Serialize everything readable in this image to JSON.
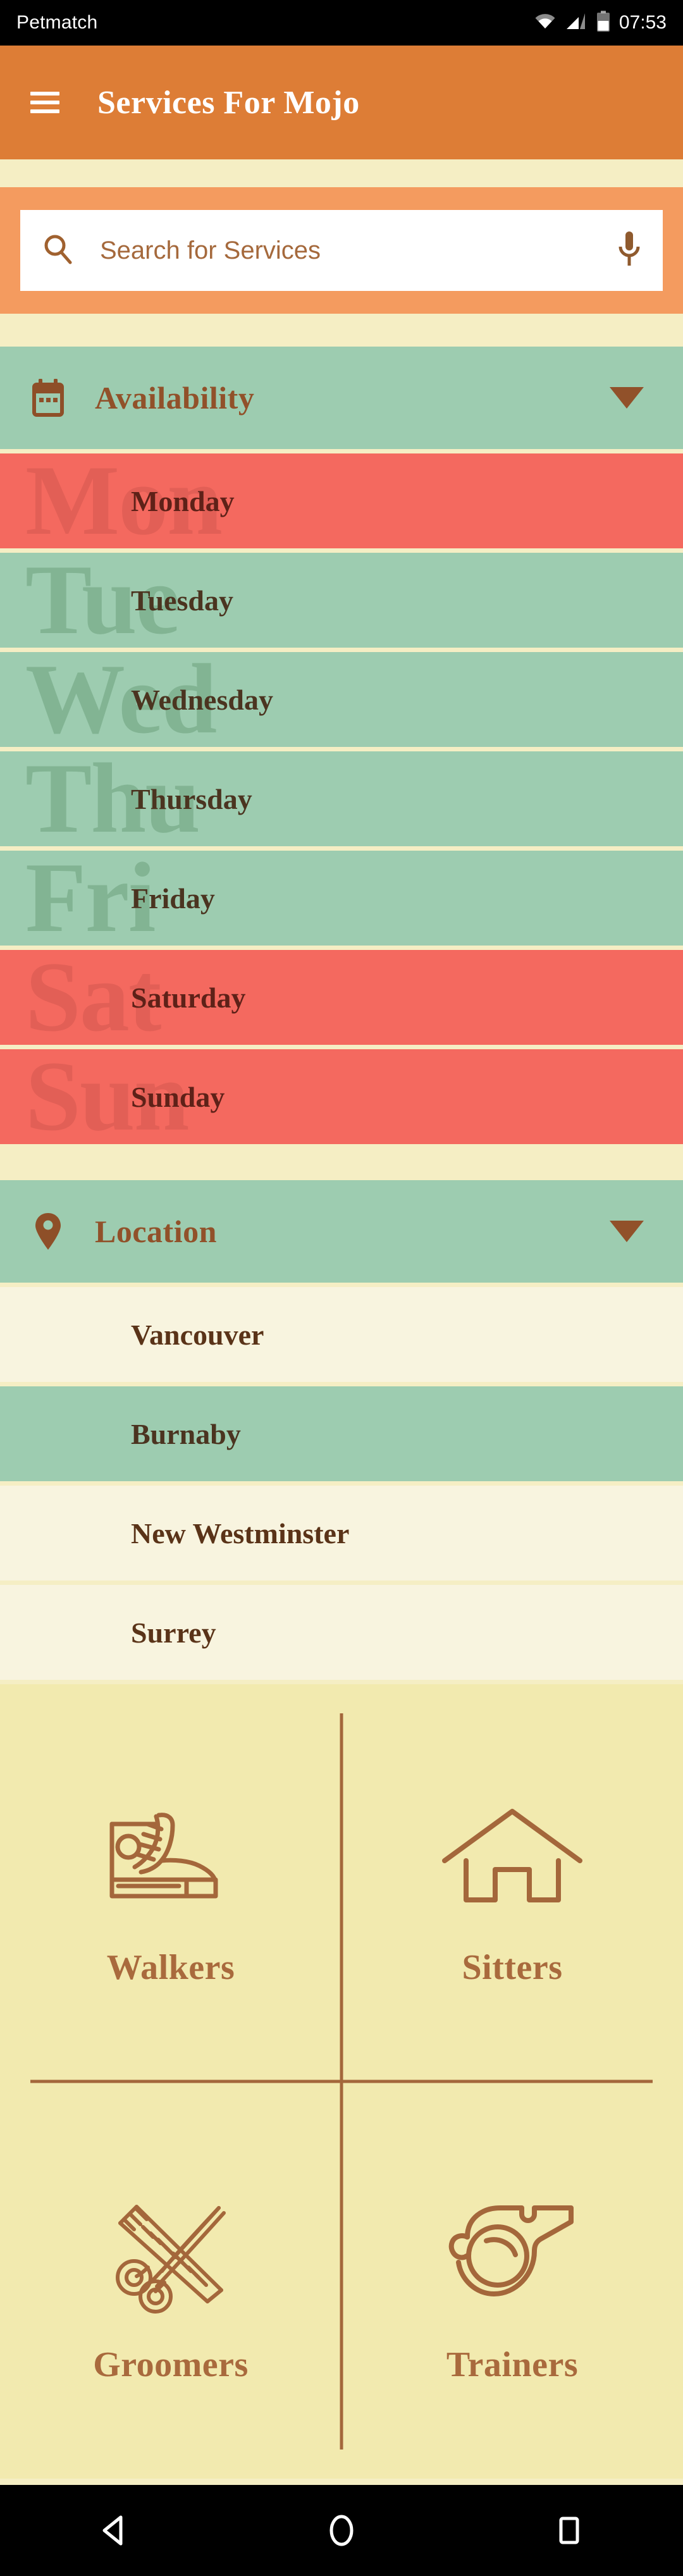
{
  "status_bar": {
    "carrier": "Petmatch",
    "clock": "07:53",
    "icons": [
      "wifi-icon",
      "cellular-signal-icon",
      "battery-icon"
    ]
  },
  "app_bar": {
    "menu_icon": "hamburger-menu-icon",
    "title": "Services For Mojo",
    "background": "#DD7D36"
  },
  "search": {
    "placeholder": "Search for Services",
    "value": "",
    "search_icon": "search-icon",
    "mic_icon": "microphone-icon",
    "bar_background": "#F49B5F"
  },
  "availability": {
    "icon": "calendar-icon",
    "title": "Availability",
    "caret": "chevron-down-icon",
    "header_background": "#9DCCB0",
    "days": [
      {
        "label": "Monday",
        "watermark": "Mon",
        "state": "unavailable"
      },
      {
        "label": "Tuesday",
        "watermark": "Tue",
        "state": "available"
      },
      {
        "label": "Wednesday",
        "watermark": "Wed",
        "state": "available"
      },
      {
        "label": "Thursday",
        "watermark": "Thu",
        "state": "available"
      },
      {
        "label": "Friday",
        "watermark": "Fri",
        "state": "available"
      },
      {
        "label": "Saturday",
        "watermark": "Sat",
        "state": "unavailable"
      },
      {
        "label": "Sunday",
        "watermark": "Sun",
        "state": "unavailable"
      }
    ],
    "colors": {
      "available": "#9DCCB0",
      "unavailable": "#F4695F"
    }
  },
  "location": {
    "icon": "map-pin-icon",
    "title": "Location",
    "caret": "chevron-down-icon",
    "header_background": "#9DCCB0",
    "items": [
      {
        "label": "Vancouver",
        "selected": false
      },
      {
        "label": "Burnaby",
        "selected": true
      },
      {
        "label": "New Westminster",
        "selected": false
      },
      {
        "label": "Surrey",
        "selected": false
      }
    ],
    "colors": {
      "normal": "#F8F4DF",
      "selected": "#9DCCB0"
    }
  },
  "services": {
    "background": "#F2EAAF",
    "accent": "#A96A3D",
    "items": [
      {
        "label": "Walkers",
        "icon": "sneaker-shoe-icon"
      },
      {
        "label": "Sitters",
        "icon": "house-icon"
      },
      {
        "label": "Groomers",
        "icon": "scissors-comb-icon"
      },
      {
        "label": "Trainers",
        "icon": "whistle-icon"
      }
    ]
  },
  "nav_bar": {
    "back": "back-triangle-icon",
    "home": "home-circle-icon",
    "recents": "recents-square-icon"
  }
}
